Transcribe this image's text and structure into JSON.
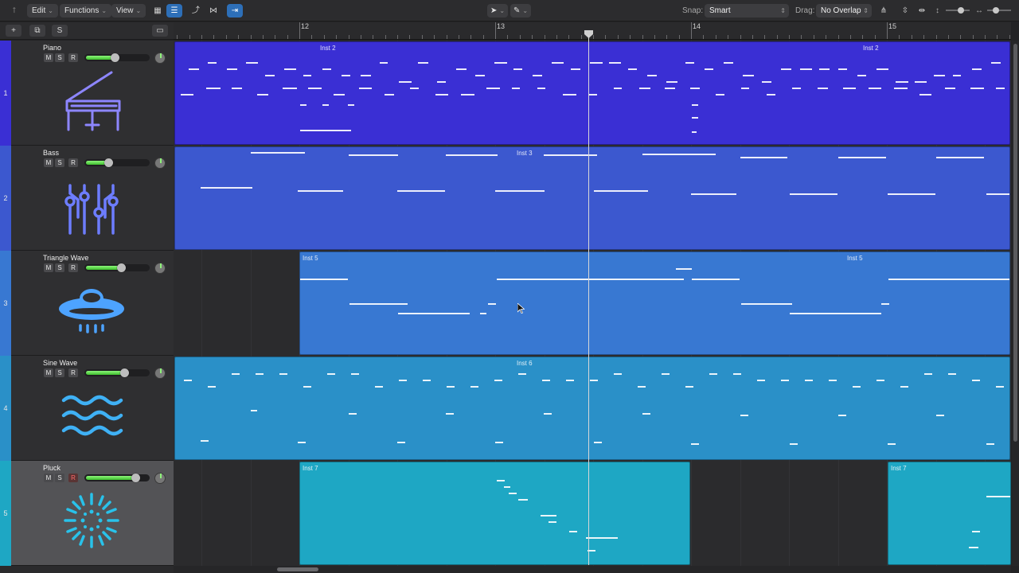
{
  "toolbar": {
    "edit_label": "Edit",
    "functions_label": "Functions",
    "view_label": "View",
    "snap_label": "Snap:",
    "snap_value": "Smart",
    "drag_label": "Drag:",
    "drag_value": "No Overlap"
  },
  "track_header_buttons": {
    "add": "+",
    "duplicate": "⧉",
    "solo": "S",
    "global": "▭"
  },
  "ruler": {
    "bars": [
      "12",
      "13",
      "14",
      "15"
    ]
  },
  "tracks": [
    {
      "number": "1",
      "name": "Piano",
      "icon": "piano-icon",
      "color": "#3a2fd4",
      "volume": 0.45,
      "m": "M",
      "s": "S",
      "r": "R",
      "regions": [
        {
          "label": "Inst 2",
          "second_label": "Inst 2"
        }
      ]
    },
    {
      "number": "2",
      "name": "Bass",
      "icon": "synth-knobs-icon",
      "color": "#3c58cf",
      "volume": 0.35,
      "m": "M",
      "s": "S",
      "r": "R",
      "regions": [
        {
          "label": "Inst 3"
        }
      ]
    },
    {
      "number": "3",
      "name": "Triangle Wave",
      "icon": "ufo-icon",
      "color": "#3878d2",
      "volume": 0.55,
      "m": "M",
      "s": "S",
      "r": "R",
      "regions": [
        {
          "label": "Inst 5",
          "second_label": "Inst 5"
        }
      ]
    },
    {
      "number": "4",
      "name": "Sine Wave",
      "icon": "waves-icon",
      "color": "#2a90c8",
      "volume": 0.6,
      "m": "M",
      "s": "S",
      "r": "R",
      "regions": [
        {
          "label": "Inst 6"
        }
      ]
    },
    {
      "number": "5",
      "name": "Pluck",
      "icon": "sparkle-icon",
      "color": "#1ea7c4",
      "volume": 0.78,
      "m": "M",
      "s": "S",
      "r": "R",
      "regions": [
        {
          "label": "Inst 7"
        },
        {
          "label": "Inst 7"
        }
      ]
    }
  ],
  "colors": {
    "accent": "#2d6fb8",
    "meter": "#5ee04a"
  }
}
